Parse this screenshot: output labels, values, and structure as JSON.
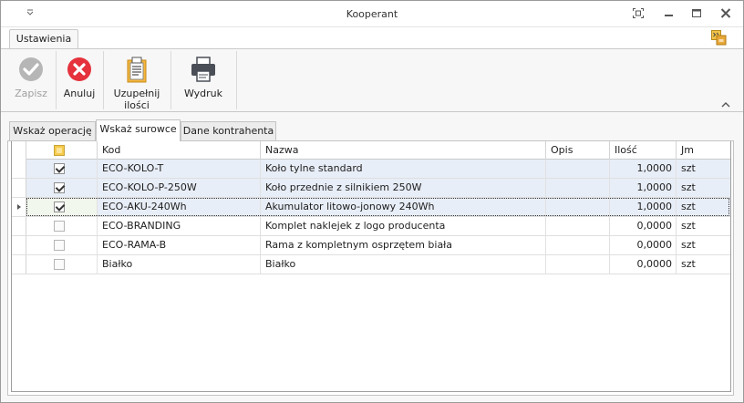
{
  "window": {
    "title": "Kooperant"
  },
  "ribbon": {
    "tab": "Ustawienia",
    "buttons": [
      {
        "id": "save",
        "label": "Zapisz",
        "icon": "check-circle-icon",
        "enabled": false
      },
      {
        "id": "cancel",
        "label": "Anuluj",
        "icon": "x-circle-icon",
        "enabled": true
      },
      {
        "id": "fill",
        "label_line1": "Uzupełnij",
        "label_line2": "ilości",
        "icon": "clipboard-icon",
        "enabled": true
      },
      {
        "id": "print",
        "label": "Wydruk",
        "icon": "printer-icon",
        "enabled": true
      }
    ]
  },
  "tabs": [
    {
      "label": "Wskaż operację",
      "active": false
    },
    {
      "label": "Wskaż surowce",
      "active": true
    },
    {
      "label": "Dane kontrahenta",
      "active": false
    }
  ],
  "grid": {
    "columns": {
      "code": "Kod",
      "name": "Nazwa",
      "desc": "Opis",
      "qty": "Ilość",
      "unit": "Jm"
    },
    "rows": [
      {
        "checked": true,
        "code": "ECO-KOLO-T",
        "name": "Koło tylne standard",
        "desc": "",
        "qty": "1,0000",
        "unit": "szt"
      },
      {
        "checked": true,
        "code": "ECO-KOLO-P-250W",
        "name": "Koło przednie z silnikiem 250W",
        "desc": "",
        "qty": "1,0000",
        "unit": "szt"
      },
      {
        "checked": true,
        "code": "ECO-AKU-240Wh",
        "name": "Akumulator litowo-jonowy 240Wh",
        "desc": "",
        "qty": "1,0000",
        "unit": "szt"
      },
      {
        "checked": false,
        "code": "ECO-BRANDING",
        "name": "Komplet naklejek z logo producenta",
        "desc": "",
        "qty": "0,0000",
        "unit": "szt"
      },
      {
        "checked": false,
        "code": "ECO-RAMA-B",
        "name": "Rama z kompletnym osprzętem biała",
        "desc": "",
        "qty": "0,0000",
        "unit": "szt"
      },
      {
        "checked": false,
        "code": "Białko",
        "name": "Białko",
        "desc": "",
        "qty": "0,0000",
        "unit": "szt"
      }
    ]
  },
  "colors": {
    "accent": "#e8eef7",
    "cancel_red": "#e5323c",
    "disabled_gray": "#a0a0a0"
  }
}
